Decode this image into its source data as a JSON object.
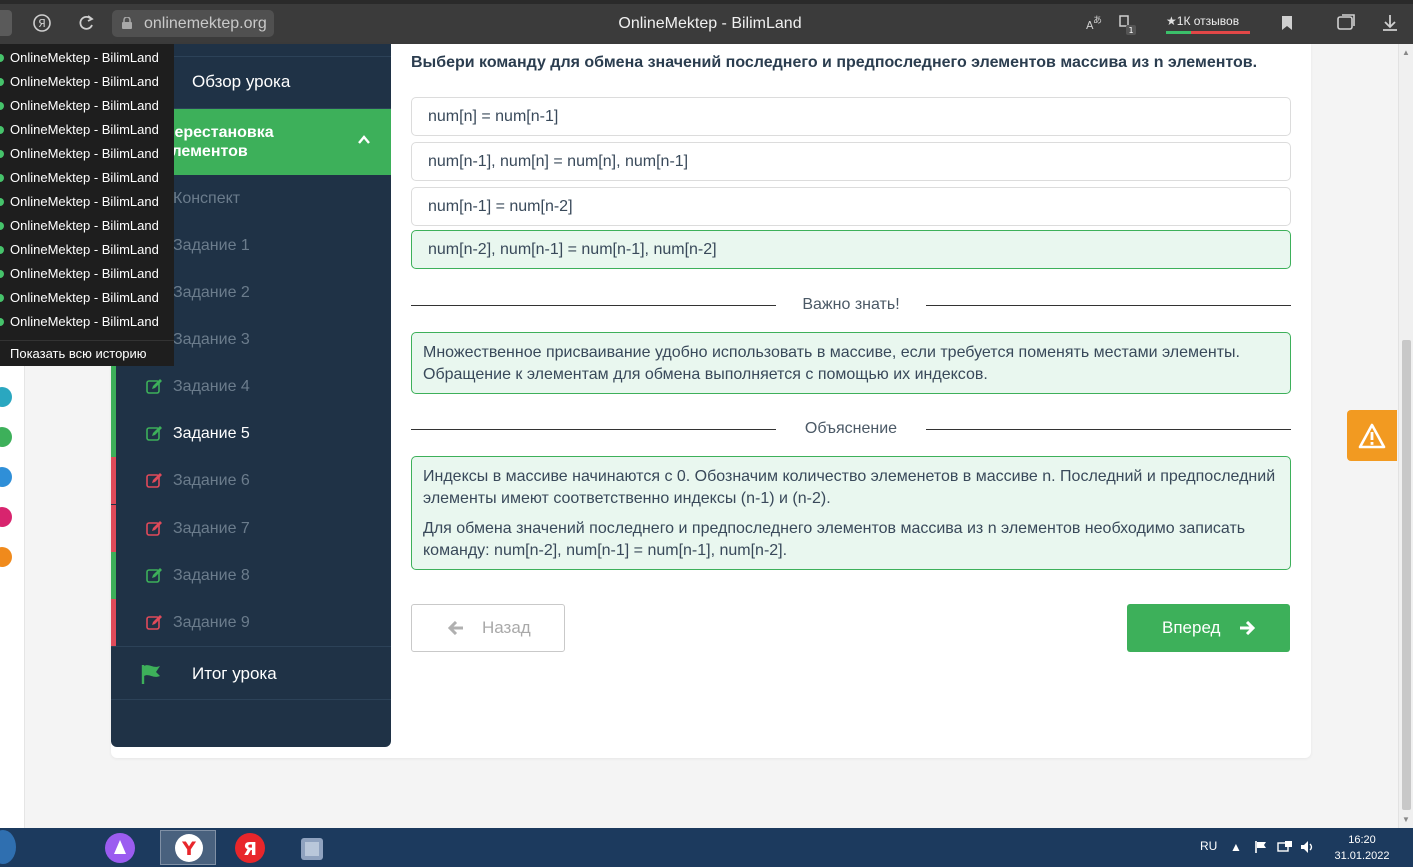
{
  "browser": {
    "url": "onlinemektep.org",
    "title": "OnlineMektep - BilimLand",
    "reviews": "1К отзывов",
    "tab_badge": "1"
  },
  "history": {
    "items": [
      "OnlineMektep - BilimLand",
      "OnlineMektep - BilimLand",
      "OnlineMektep - BilimLand",
      "OnlineMektep - BilimLand",
      "OnlineMektep - BilimLand",
      "OnlineMektep - BilimLand",
      "OnlineMektep - BilimLand",
      "OnlineMektep - BilimLand",
      "OnlineMektep - BilimLand",
      "OnlineMektep - BilimLand",
      "OnlineMektep - BilimLand",
      "OnlineMektep - BilimLand"
    ],
    "show_all": "Показать всю историю"
  },
  "sidebar": {
    "overview": "Обзор урока",
    "section_line1": "Перестановка",
    "section_line2": "элементов",
    "summary": "Конспект",
    "tasks": [
      {
        "label": "Задание 1",
        "status": "none"
      },
      {
        "label": "Задание 2",
        "status": "none"
      },
      {
        "label": "Задание 3",
        "status": "none"
      },
      {
        "label": "Задание 4",
        "status": "correct"
      },
      {
        "label": "Задание 5",
        "status": "correct"
      },
      {
        "label": "Задание 6",
        "status": "wrong"
      },
      {
        "label": "Задание 7",
        "status": "wrong"
      },
      {
        "label": "Задание 8",
        "status": "correct"
      },
      {
        "label": "Задание 9",
        "status": "wrong"
      }
    ],
    "final": "Итог урока",
    "colors": {
      "correct": "#3db05a",
      "wrong": "#e04a5a"
    }
  },
  "main": {
    "question": "Выбери команду для обмена значений последнего и предпоследнего элементов массива из n элементов.",
    "options": [
      "num[n] = num[n-1]",
      "num[n-1], num[n] = num[n], num[n-1]",
      "num[n-1] = num[n-2]",
      "num[n-2], num[n-1] = num[n-1], num[n-2]"
    ],
    "correct_option_index": 3,
    "important_title": "Важно знать!",
    "important_text": "Множественное присваивание удобно использовать в массиве, если требуется поменять местами элементы. Обращение к элементам для обмена выполняется с помощью их индексов.",
    "explanation_title": "Объяснение",
    "explanation_p1": "Индексы в массиве начинаются с 0. Обозначим количество элеменетов в массиве n. Последний и предпоследний элементы имеют соответственно индексы (n-1) и (n-2).",
    "explanation_p2": "Для обмена значений последнего и предпоследнего элементов массива из n элементов необходимо записать команду: num[n-2], num[n-1] = num[n-1], num[n-2].",
    "back_label": "Назад",
    "next_label": "Вперед"
  },
  "taskbar": {
    "lang": "RU",
    "time": "16:20",
    "date": "31.01.2022"
  }
}
